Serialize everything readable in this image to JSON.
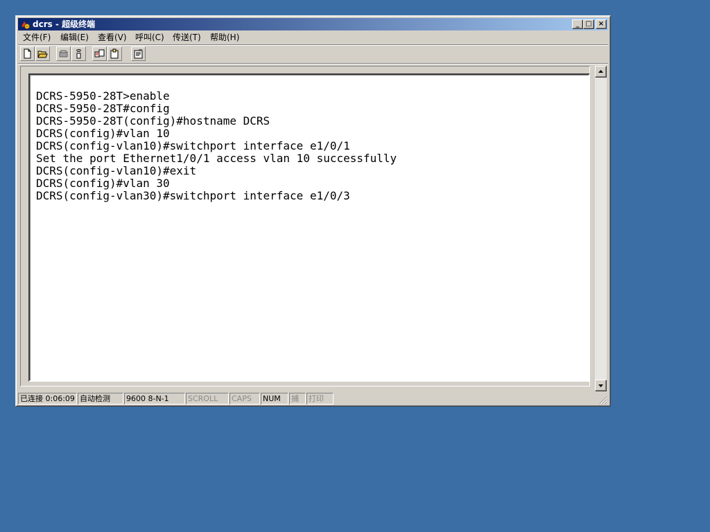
{
  "window": {
    "title": "dcrs - 超级终端",
    "icon": "hyperterminal-icon",
    "controls": {
      "minimize": "_",
      "maximize": "□",
      "close": "×"
    }
  },
  "menu": {
    "items": [
      {
        "label": "文件(F)"
      },
      {
        "label": "编辑(E)"
      },
      {
        "label": "查看(V)"
      },
      {
        "label": "呼叫(C)"
      },
      {
        "label": "传送(T)"
      },
      {
        "label": "帮助(H)"
      }
    ]
  },
  "toolbar": {
    "buttons": [
      "new-icon",
      "open-icon",
      "disconnect-icon",
      "call-icon",
      "send-file-icon",
      "receive-file-icon",
      "properties-icon"
    ]
  },
  "terminal": {
    "lines": [
      "DCRS-5950-28T>enable",
      "DCRS-5950-28T#config",
      "DCRS-5950-28T(config)#hostname DCRS",
      "DCRS(config)#vlan 10",
      "DCRS(config-vlan10)#switchport interface e1/0/1",
      "Set the port Ethernet1/0/1 access vlan 10 successfully",
      "DCRS(config-vlan10)#exit",
      "DCRS(config)#vlan 30",
      "DCRS(config-vlan30)#switchport interface e1/0/3"
    ]
  },
  "statusbar": {
    "connection": "已连接 0:06:09",
    "detect": "自动检测",
    "settings": "9600 8-N-1",
    "scroll": "SCROLL",
    "caps": "CAPS",
    "num": "NUM",
    "capture": "捕",
    "print": "打印"
  },
  "colors": {
    "desktop": "#3a6ea5",
    "titlebar_start": "#0a246a",
    "titlebar_end": "#a6caf0",
    "face": "#d4d0c8"
  }
}
